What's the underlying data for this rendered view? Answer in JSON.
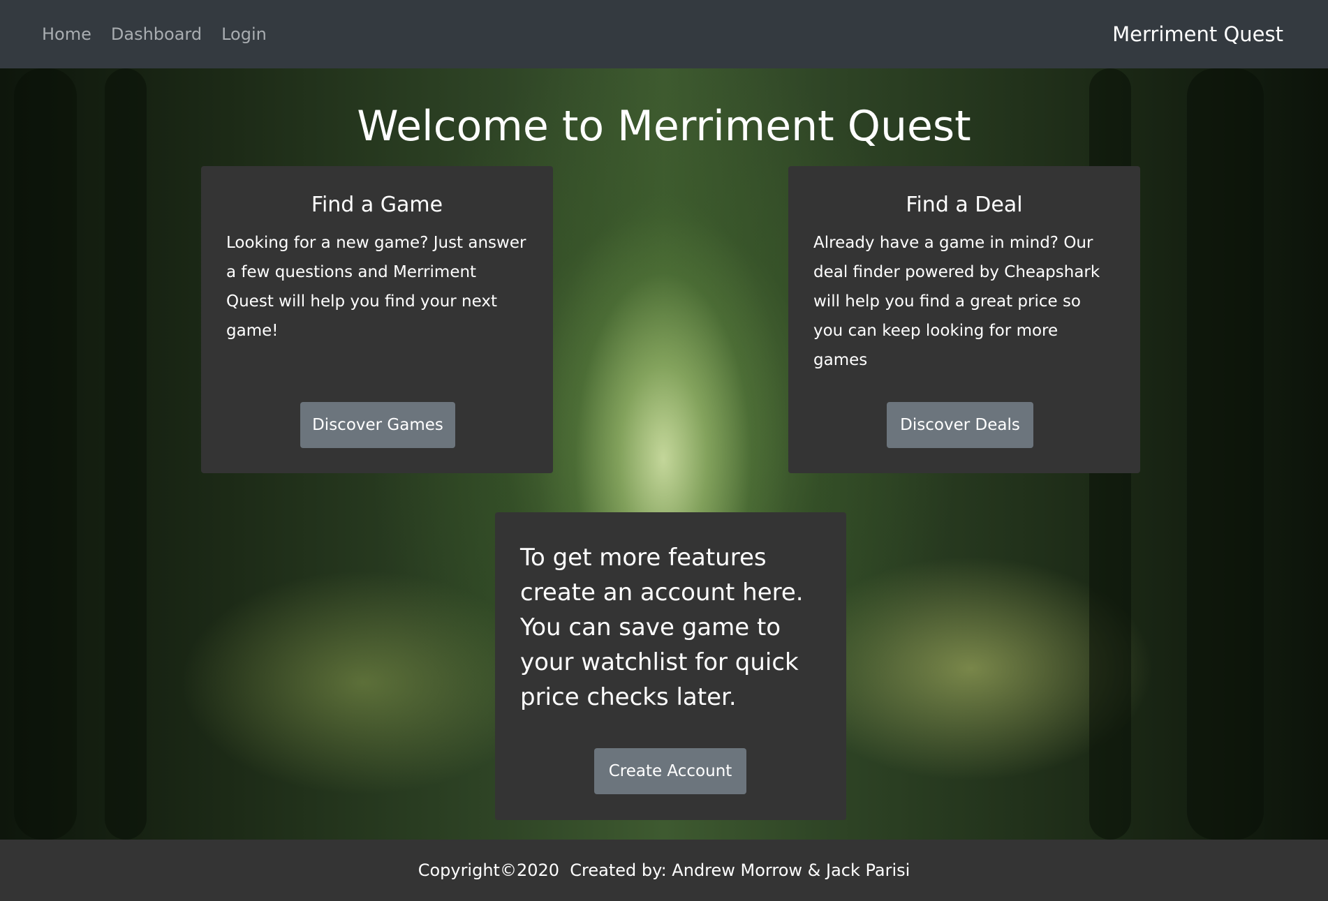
{
  "nav": {
    "links": [
      "Home",
      "Dashboard",
      "Login"
    ],
    "brand": "Merriment Quest"
  },
  "hero": {
    "title": "Welcome to Merriment Quest"
  },
  "cards": {
    "game": {
      "title": "Find a Game",
      "text": "Looking for a new game? Just answer a few questions and Merriment Quest will help you find your next game!",
      "button": "Discover Games"
    },
    "deal": {
      "title": "Find a Deal",
      "text": "Already have a game in mind? Our deal finder powered by Cheapshark will help you find a great price so you can keep looking for more games",
      "button": "Discover Deals"
    },
    "account": {
      "text": "To get more features create an account here. You can save game to your watchlist for quick price checks later.",
      "button": "Create Account"
    }
  },
  "footer": {
    "text": "Copyright©2020  Created by: Andrew Morrow & Jack Parisi"
  },
  "colors": {
    "navbar": "#343a40",
    "card": "#343434",
    "button": "#6c757d",
    "footer": "#343434"
  }
}
